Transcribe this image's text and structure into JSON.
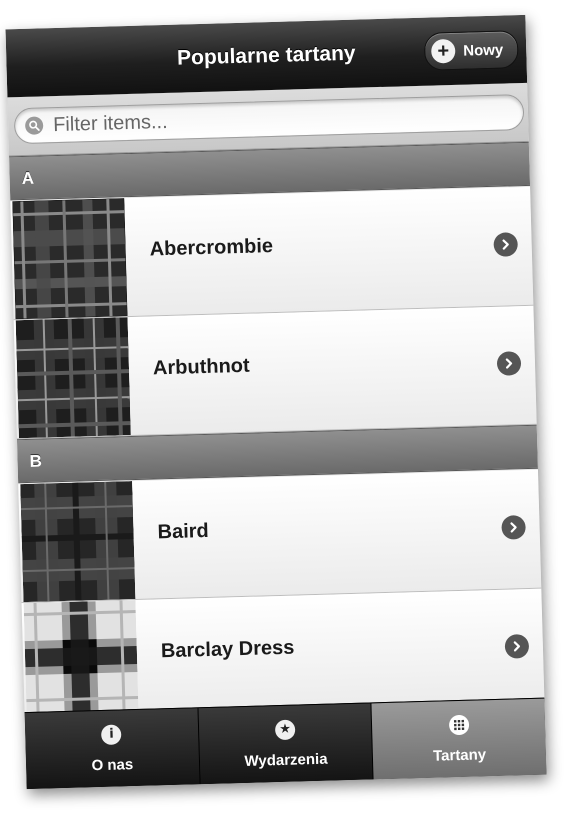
{
  "header": {
    "title": "Popularne tartany",
    "new_button_label": "Nowy"
  },
  "search": {
    "placeholder": "Filter items..."
  },
  "list": {
    "groups": [
      {
        "letter": "A",
        "items": [
          {
            "name": "Abercrombie"
          },
          {
            "name": "Arbuthnot"
          }
        ]
      },
      {
        "letter": "B",
        "items": [
          {
            "name": "Baird"
          },
          {
            "name": "Barclay Dress"
          }
        ]
      }
    ]
  },
  "tabbar": {
    "tabs": [
      {
        "label": "O nas",
        "icon": "info-icon",
        "active": false
      },
      {
        "label": "Wydarzenia",
        "icon": "star-icon",
        "active": false
      },
      {
        "label": "Tartany",
        "icon": "grid-icon",
        "active": true
      }
    ]
  },
  "colors": {
    "header_dark": "#1f1f1f",
    "divider_gray": "#7a7a7a",
    "active_tab": "#8a8a8a"
  }
}
